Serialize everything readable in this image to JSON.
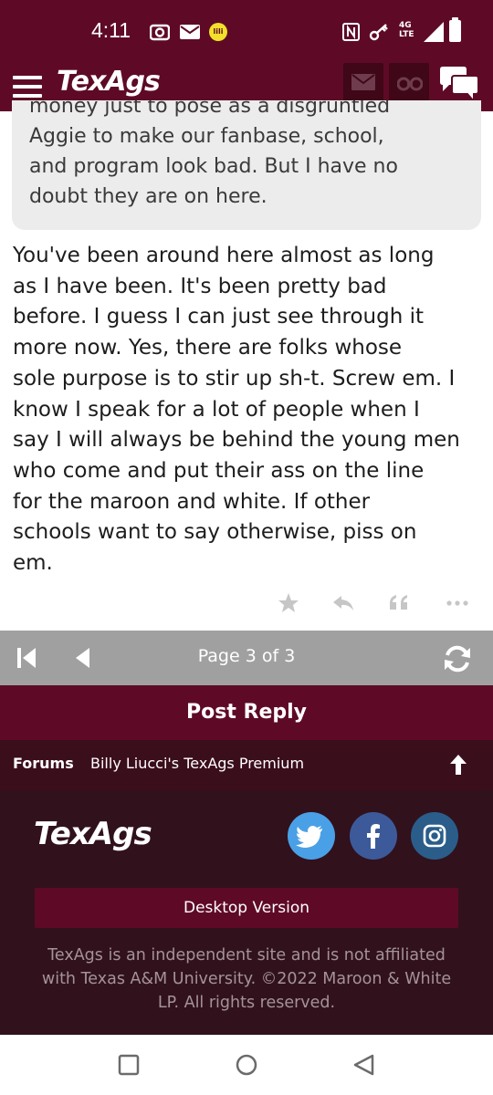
{
  "status_bar": {
    "time": "4:11",
    "yellow_badge": "lili",
    "network_top": "4G",
    "network_bottom": "LTE",
    "icons": [
      "camera-icon",
      "mail-icon",
      "lili-app-icon",
      "nfc-icon",
      "vpn-key-icon",
      "network-4g-icon",
      "signal-icon",
      "battery-icon"
    ]
  },
  "header": {
    "logo": "TexAgs",
    "icons": [
      "menu-icon",
      "mail-icon",
      "binoculars-icon",
      "chat-icon"
    ]
  },
  "quote": {
    "text": "money just to pose as a disgruntled\nAggie to make our fanbase, school,\nand program look bad. But I have no\ndoubt they are on here."
  },
  "post": {
    "text": "You've been around here almost as long\nas I have been. It's been pretty bad\nbefore. I guess I can just see through it\nmore now. Yes, there are folks whose\nsole purpose is to stir up sh-t. Screw em. I\nknow I speak for a lot of people when I\nsay I will always be behind the young men\nwho come and put their ass on the line\nfor the maroon and white. If other\nschools want to say otherwise, piss on\nem.",
    "actions": [
      "star-icon",
      "reply-icon",
      "quote-icon",
      "more-icon"
    ]
  },
  "pager": {
    "label": "Page 3 of 3"
  },
  "post_reply": {
    "label": "Post Reply"
  },
  "breadcrumb": {
    "forums": "Forums",
    "board": "Billy Liucci's TexAgs Premium"
  },
  "footer": {
    "logo": "TexAgs",
    "desktop_version": "Desktop Version",
    "disclaimer": "TexAgs is an independent site and is not affiliated with Texas A&M University. ©2022 Maroon & White LP. All rights reserved.",
    "social": [
      "twitter-icon",
      "facebook-icon",
      "instagram-icon"
    ]
  },
  "colors": {
    "maroon": "#5e0a26",
    "breadcrumb_bg": "#3b0e1c",
    "footer_bg": "#31111c",
    "pager_bg": "#a0a0a0",
    "quote_bg": "#ececec",
    "twitter": "#4aa0e6",
    "facebook": "#3c5a9a",
    "instagram": "#2a5d8a"
  }
}
